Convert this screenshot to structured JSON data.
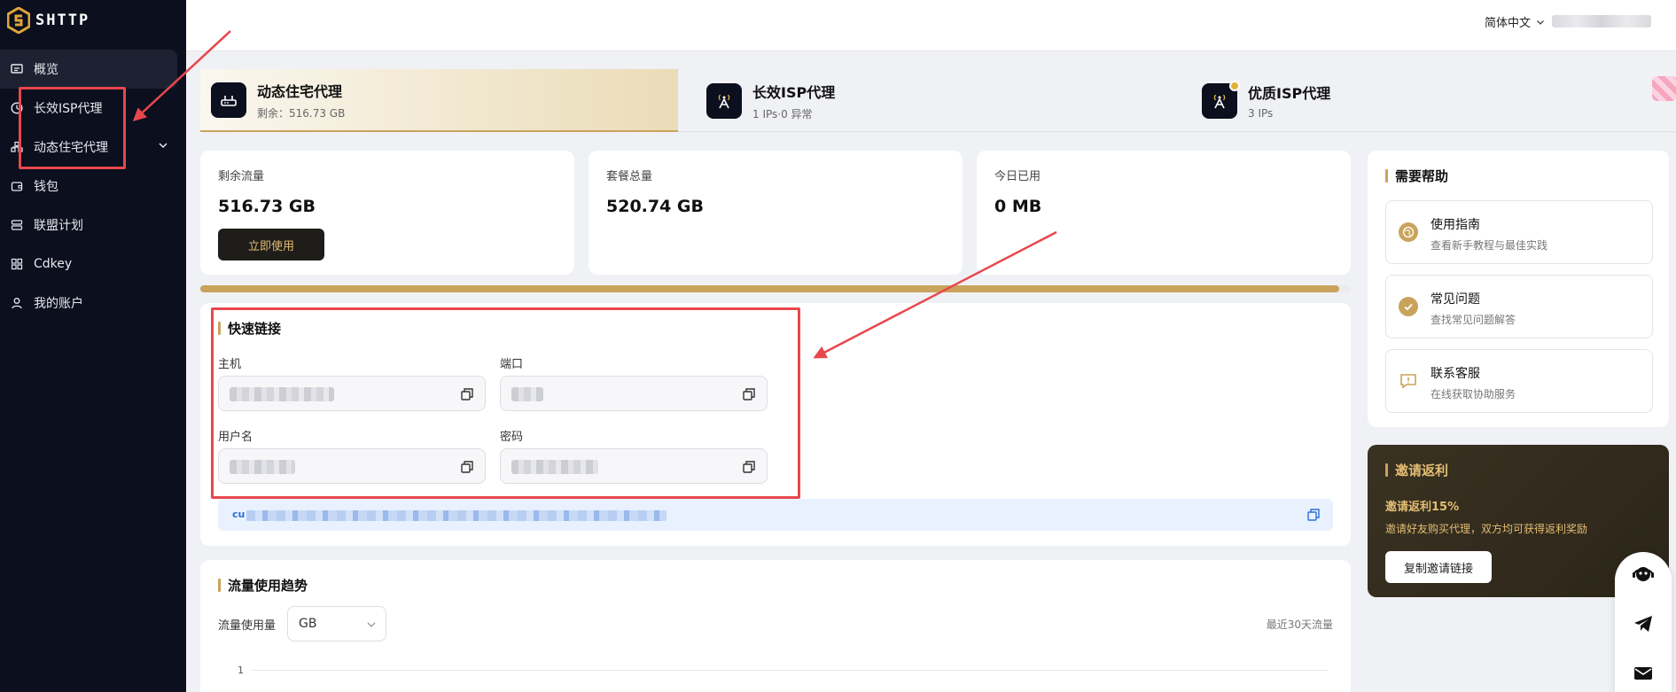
{
  "app": {
    "logo_text": "SHTTP"
  },
  "sidebar": {
    "items": [
      {
        "label": "概览",
        "icon": "monitor-icon"
      },
      {
        "label": "长效ISP代理",
        "icon": "clock-icon"
      },
      {
        "label": "动态住宅代理",
        "icon": "network-icon"
      },
      {
        "label": "钱包",
        "icon": "wallet-icon"
      },
      {
        "label": "联盟计划",
        "icon": "server-icon"
      },
      {
        "label": "Cdkey",
        "icon": "key-grid-icon"
      },
      {
        "label": "我的账户",
        "icon": "user-icon"
      }
    ]
  },
  "header": {
    "language": "简体中文"
  },
  "product_tabs": [
    {
      "title": "动态住宅代理",
      "sub": "剩余：516.73 GB"
    },
    {
      "title": "长效ISP代理",
      "sub": "1 IPs·0 异常"
    },
    {
      "title": "优质ISP代理",
      "sub": "3 IPs"
    }
  ],
  "stats": {
    "remaining_label": "剩余流量",
    "remaining_value": "516.73 GB",
    "use_button": "立即使用",
    "total_label": "套餐总量",
    "total_value": "520.74 GB",
    "today_label": "今日已用",
    "today_value": "0 MB",
    "usage_fraction": 0.99
  },
  "quick_link": {
    "title": "快速链接",
    "host_label": "主机",
    "port_label": "端口",
    "username_label": "用户名",
    "password_label": "密码",
    "curl_prefix": "cu"
  },
  "traffic": {
    "title": "流量使用趋势",
    "unit_label": "流量使用量",
    "unit_value": "GB",
    "range_note": "最近30天流量",
    "y_tick": "1"
  },
  "help": {
    "title": "需要帮助",
    "items": [
      {
        "title": "使用指南",
        "sub": "查看新手教程与最佳实践"
      },
      {
        "title": "常见问题",
        "sub": "查找常见问题解答"
      },
      {
        "title": "联系客服",
        "sub": "在线获取协助服务"
      }
    ]
  },
  "invite": {
    "title": "邀请返利",
    "rate": "邀请返利15%",
    "desc": "邀请好友购买代理，双方均可获得返利奖励",
    "button": "复制邀请链接"
  },
  "colors": {
    "accent": "#c9a35c",
    "sidebar_bg": "#0b0f1e",
    "annotation": "#e8474d"
  }
}
